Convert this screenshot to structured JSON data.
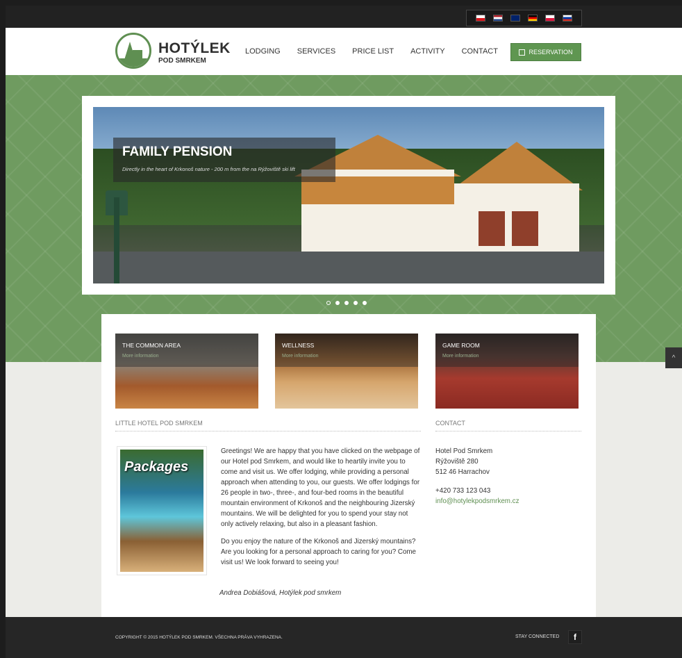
{
  "languages": [
    {
      "name": "czech-flag-icon",
      "color": "#d7141a"
    },
    {
      "name": "dutch-flag-icon",
      "color": "#ae1c28"
    },
    {
      "name": "uk-flag-icon",
      "color": "#012169"
    },
    {
      "name": "german-flag-icon",
      "color": "#ffce00"
    },
    {
      "name": "polish-flag-icon",
      "color": "#dc143c"
    },
    {
      "name": "russian-flag-icon",
      "color": "#0039a6"
    }
  ],
  "logo": {
    "title": "HOTÝLEK",
    "subtitle": "POD SMRKEM"
  },
  "nav": {
    "lodging": "LODGING",
    "services": "SERVICES",
    "price_list": "PRICE LIST",
    "activity": "ACTIVITY",
    "contact": "CONTACT"
  },
  "reservation_label": "RESERVATION",
  "slider": {
    "title": "FAMILY PENSION",
    "subtitle": "Directly in the heart of Krkonoš nature - 200 m from the na Rýžoviště ski lift",
    "active_dot": 1,
    "dot_count": 5
  },
  "tiles": [
    {
      "label": "THE COMMON AREA",
      "more": "More information"
    },
    {
      "label": "WELLNESS",
      "more": "More information"
    },
    {
      "label": "GAME ROOM",
      "more": "More information"
    }
  ],
  "about": {
    "heading": "LITTLE HOTEL POD SMRKEM",
    "packages_label": "Packages",
    "para1": "Greetings! We are happy that you have clicked on the webpage of our Hotel pod Smrkem, and would like to heartily invite you to come and visit us. We offer lodging, while providing a personal approach when attending to you, our guests. We offer lodgings for 26 people in two-, three-, and four-bed rooms in the beautiful mountain environment of Krkonoš and the neighbouring Jizerský mountains. We will be delighted for you to spend your stay not only actively relaxing, but also in a pleasant fashion.",
    "para2": "Do you enjoy the nature of the Krkonoš and Jizerský mountains? Are you looking for a personal approach to caring for you? Come visit us! We look forward to seeing you!",
    "signature": "Andrea Dobiášová, Hotýlek pod smrkem"
  },
  "contact": {
    "heading": "CONTACT",
    "name": "Hotel Pod Smrkem",
    "street": "Rýžoviště 280",
    "city": "512 46 Harrachov",
    "phone": "+420 733 123 043",
    "email": "info@hotylekpodsmrkem.cz"
  },
  "footer": {
    "copyright": "COPYRIGHT © 2015 HOTÝLEK POD SMRKEM. VŠECHNA PRÁVA VYHRAZENA.",
    "stay_connected": "STAY CONNECTED",
    "facebook": "f"
  },
  "to_top": "^"
}
